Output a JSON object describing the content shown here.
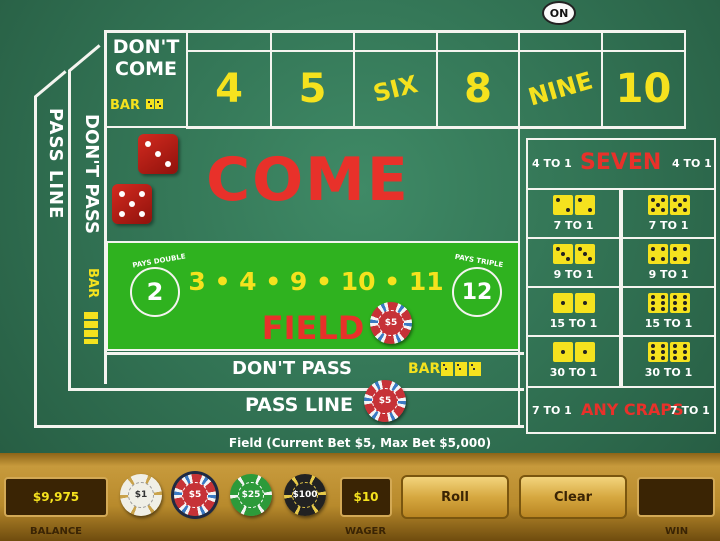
{
  "puck": "ON",
  "dont_come": {
    "line1": "DON'T",
    "line2": "COME",
    "bar": "BAR"
  },
  "place_numbers": [
    "4",
    "5",
    "SIX",
    "8",
    "NINE",
    "10"
  ],
  "pass_line_side": "PASS LINE",
  "dont_pass_side": "DON'T PASS",
  "bar_side": "BAR",
  "come": "COME",
  "field": {
    "pays_double": "PAYS DOUBLE",
    "pays_triple": "PAYS TRIPLE",
    "double_number": "2",
    "triple_number": "12",
    "numbers": "3 • 4 • 9 • 10 • 11",
    "label": "FIELD"
  },
  "dont_pass_bottom": "DON'T PASS",
  "bar_bottom": "BAR",
  "pass_line_bottom": "PASS LINE",
  "props": {
    "seven_odds_left": "4 TO 1",
    "seven": "SEVEN",
    "seven_odds_right": "4 TO 1",
    "cells": [
      {
        "odds": "7 TO 1",
        "dice": [
          2,
          2
        ]
      },
      {
        "odds": "7 TO 1",
        "dice": [
          5,
          5
        ]
      },
      {
        "odds": "9 TO 1",
        "dice": [
          3,
          3
        ]
      },
      {
        "odds": "9 TO 1",
        "dice": [
          4,
          4
        ]
      },
      {
        "odds": "15 TO 1",
        "dice": [
          1,
          1
        ]
      },
      {
        "odds": "15 TO 1",
        "dice": [
          6,
          6
        ]
      },
      {
        "odds": "30 TO 1",
        "dice": [
          1,
          1
        ]
      },
      {
        "odds": "30 TO 1",
        "dice": [
          6,
          6
        ]
      }
    ],
    "craps_odds_left": "7 TO 1",
    "any_craps": "ANY CRAPS",
    "craps_odds_right": "7 TO 1"
  },
  "chips_on_table": {
    "field_chip": "$5",
    "pass_line_chip": "$5"
  },
  "status_text": "Field (Current Bet $5,  Max Bet $5,000)",
  "bottom": {
    "balance_value": "$9,975",
    "balance_label": "BALANCE",
    "chips": [
      "$1",
      "$5",
      "$25",
      "$100"
    ],
    "wager_value": "$10",
    "wager_label": "WAGER",
    "roll_label": "Roll",
    "clear_label": "Clear",
    "win_value": "",
    "win_label": "WIN"
  },
  "colors": {
    "felt": "#306f51",
    "field_green": "#2fb21f",
    "text_yellow": "#f5e21e",
    "text_red": "#e8312a",
    "dice_red": "#c4231a"
  }
}
